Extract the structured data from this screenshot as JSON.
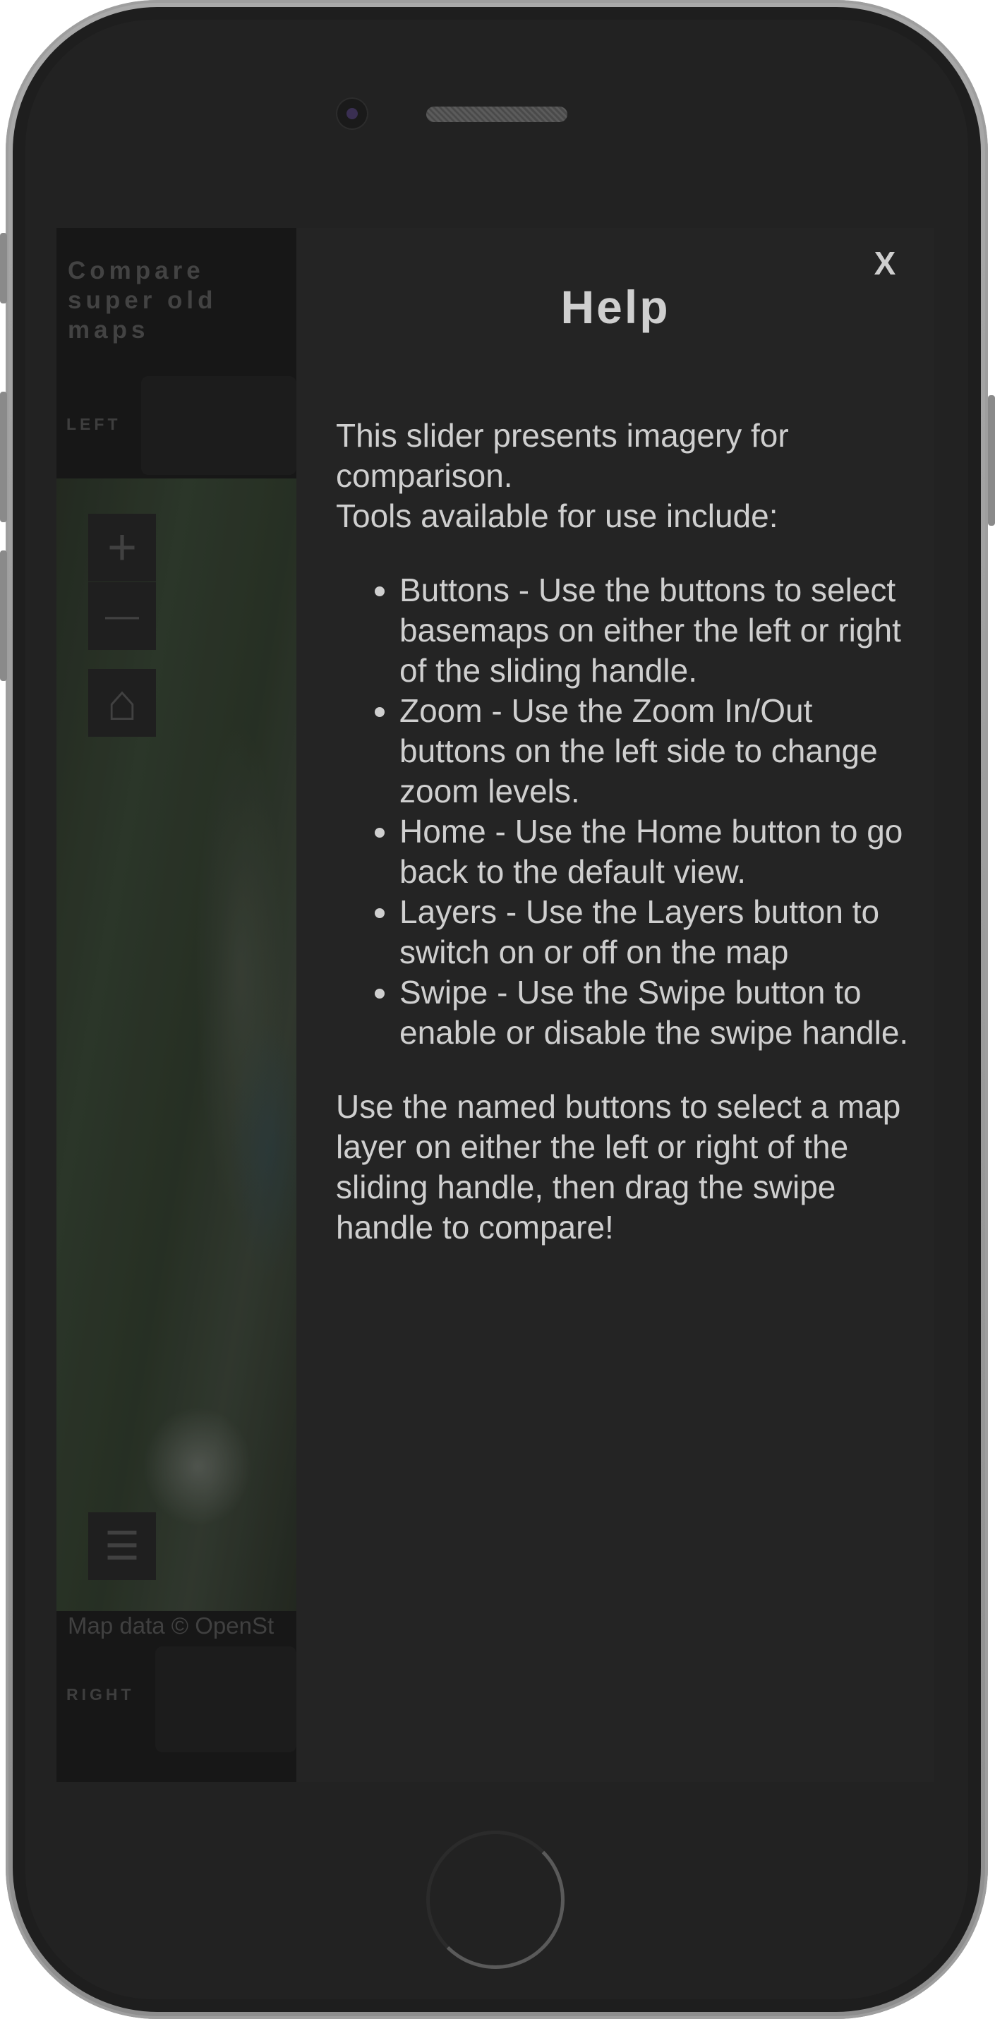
{
  "app": {
    "title": "Compare super old maps",
    "left_label": "LEFT",
    "right_label": "RIGHT",
    "attribution": "Map data © OpenSt"
  },
  "map_controls": [
    {
      "name": "zoom-in",
      "glyph": "+"
    },
    {
      "name": "zoom-out",
      "glyph": "—"
    },
    {
      "name": "home",
      "glyph": "⌂"
    },
    {
      "name": "layers",
      "glyph": "☰"
    }
  ],
  "help": {
    "close_label": "X",
    "title": "Help",
    "intro_line1": "This slider presents imagery for comparison.",
    "intro_line2": "Tools available for use include:",
    "items": [
      "Buttons - Use the buttons to select basemaps on either the left or right of the sliding handle.",
      "Zoom - Use the Zoom In/Out buttons on the left side to change zoom levels.",
      "Home - Use the Home button to go back to the default view.",
      "Layers - Use the Layers button to switch on or off on the map",
      "Swipe - Use the Swipe button to enable or disable the swipe handle."
    ],
    "outro": "Use the named buttons to select a map layer on either the left or right of the sliding handle, then drag the swipe handle to compare!"
  }
}
